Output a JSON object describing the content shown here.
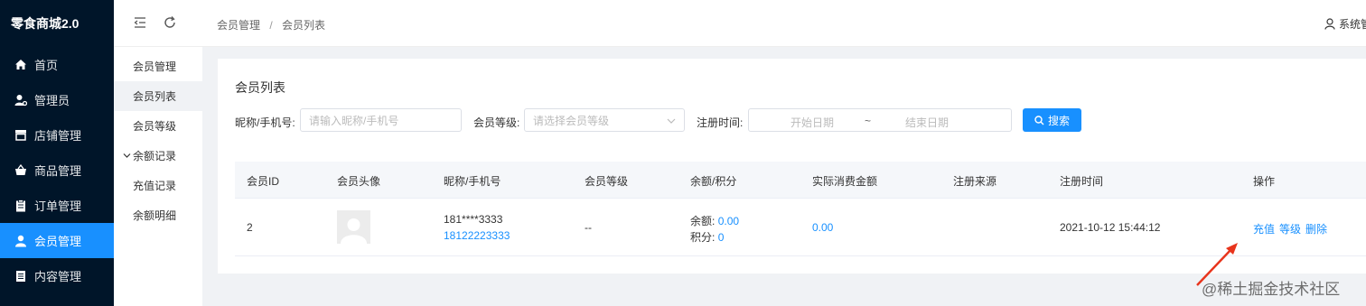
{
  "app": {
    "title": "零食商城2.0"
  },
  "menu": {
    "items": [
      {
        "label": "首页",
        "icon": "home-icon"
      },
      {
        "label": "管理员",
        "icon": "admin-user-icon"
      },
      {
        "label": "店铺管理",
        "icon": "store-icon"
      },
      {
        "label": "商品管理",
        "icon": "basket-icon"
      },
      {
        "label": "订单管理",
        "icon": "clipboard-icon"
      },
      {
        "label": "会员管理",
        "icon": "user-icon",
        "active": true
      },
      {
        "label": "内容管理",
        "icon": "document-icon"
      }
    ]
  },
  "subnav": {
    "items": [
      {
        "label": "会员管理"
      },
      {
        "label": "会员列表",
        "active": true
      },
      {
        "label": "会员等级"
      },
      {
        "label": "余额记录",
        "expanded": true
      },
      {
        "label": "充值记录"
      },
      {
        "label": "余额明细"
      }
    ]
  },
  "header": {
    "breadcrumb": [
      "会员管理",
      "会员列表"
    ],
    "breadcrumb_sep": "/",
    "user_label": "系统管"
  },
  "card": {
    "title": "会员列表"
  },
  "filters": {
    "nickname_label": "昵称/手机号:",
    "nickname_placeholder": "请输入昵称/手机号",
    "level_label": "会员等级:",
    "level_placeholder": "请选择会员等级",
    "regtime_label": "注册时间:",
    "start_placeholder": "开始日期",
    "range_sep": "~",
    "end_placeholder": "结束日期",
    "search_button": "搜索"
  },
  "table": {
    "columns": [
      "会员ID",
      "会员头像",
      "昵称/手机号",
      "会员等级",
      "余额/积分",
      "实际消费金额",
      "注册来源",
      "注册时间",
      "操作"
    ],
    "rows": [
      {
        "id": "2",
        "nickname": "181****3333",
        "phone": "18122223333",
        "level": "--",
        "balance_label": "余额:",
        "balance": "0.00",
        "points_label": "积分:",
        "points": "0",
        "spent": "0.00",
        "source": "",
        "reg_time": "2021-10-12 15:44:12",
        "actions": [
          "充值",
          "等级",
          "删除"
        ]
      }
    ]
  },
  "watermark": "@稀土掘金技术社区",
  "colors": {
    "sidebar": "#001529",
    "accent": "#1890ff",
    "annotation": "#e8341c"
  }
}
